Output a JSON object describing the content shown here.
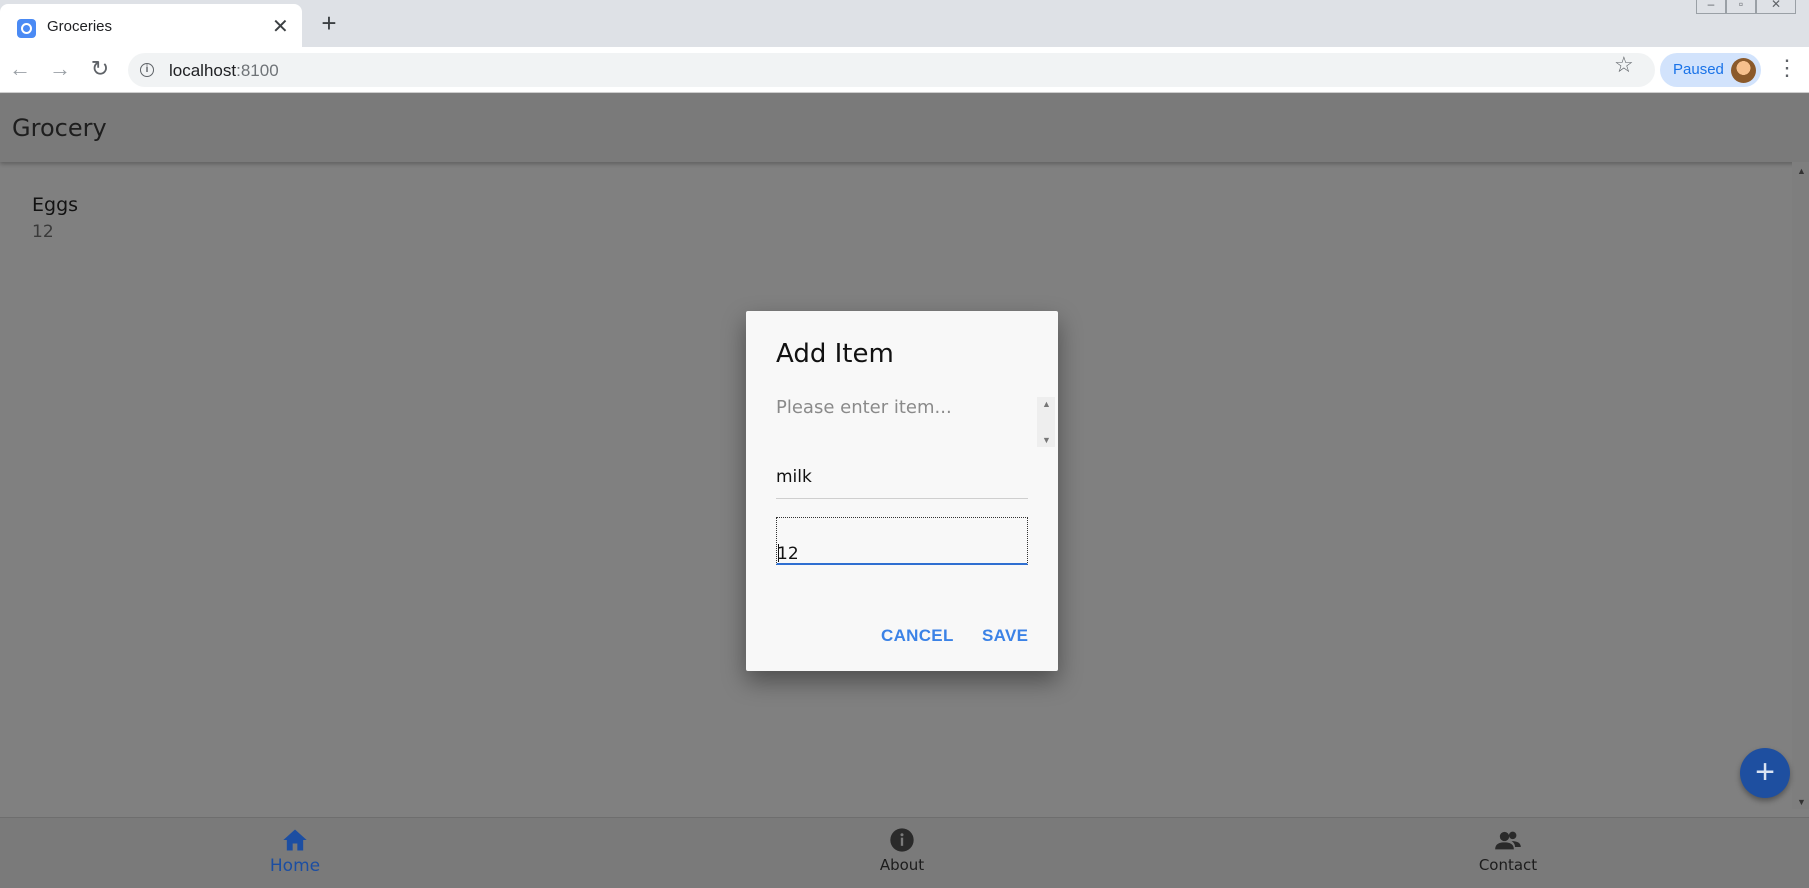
{
  "browser": {
    "tab_title": "Groceries",
    "tab_close": "✕",
    "new_tab": "+",
    "url_host": "localhost",
    "url_port": ":8100",
    "profile_status": "Paused",
    "back": "←",
    "forward": "→",
    "reload": "↻",
    "star": "☆",
    "menu": "⋮"
  },
  "app": {
    "title": "Grocery",
    "items": [
      {
        "name": "Eggs",
        "quantity": "12"
      }
    ],
    "fab_label": "+",
    "tabs": [
      {
        "label": "Home",
        "icon": "home-icon",
        "active": true
      },
      {
        "label": "About",
        "icon": "info-icon",
        "active": false
      },
      {
        "label": "Contact",
        "icon": "people-icon",
        "active": false
      }
    ]
  },
  "dialog": {
    "title": "Add Item",
    "message": "Please enter item...",
    "name_value": "milk",
    "quantity_value": "12",
    "cancel_label": "CANCEL",
    "save_label": "SAVE"
  },
  "colors": {
    "accent": "#3b82e6",
    "fab": "#1e4fa0",
    "active_tab": "#1c4ea2",
    "overlay": "#808080"
  }
}
